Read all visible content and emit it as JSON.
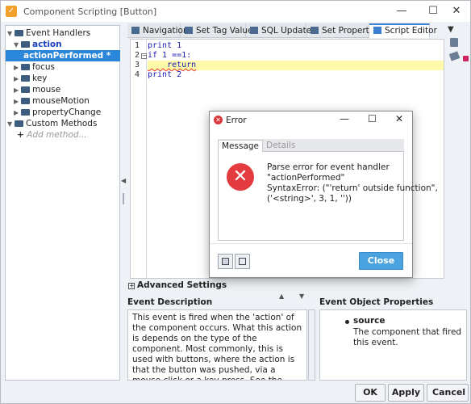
{
  "window": {
    "title": "Component Scripting [Button]",
    "controls": [
      "—",
      "☐",
      "✕"
    ]
  },
  "tree": {
    "items": [
      {
        "label": "Event Handlers"
      },
      {
        "label": "action"
      },
      {
        "label": "actionPerformed *"
      },
      {
        "label": "focus"
      },
      {
        "label": "key"
      },
      {
        "label": "mouse"
      },
      {
        "label": "mouseMotion"
      },
      {
        "label": "propertyChange"
      },
      {
        "label": "Custom Methods"
      },
      {
        "label": "Add method..."
      }
    ]
  },
  "tabs": [
    {
      "label": "Navigation"
    },
    {
      "label": "Set Tag Value"
    },
    {
      "label": "SQL Update"
    },
    {
      "label": "Set Property"
    },
    {
      "label": "Script Editor"
    }
  ],
  "editor": {
    "line_numbers": [
      "1",
      "2",
      "3",
      "4"
    ],
    "lines": [
      "print 1",
      "if 1 ==1:",
      "    return",
      "print 2"
    ]
  },
  "advanced_settings_label": "Advanced Settings",
  "event_description": {
    "heading": "Event Description",
    "text": "This event is fired when the 'action' of the component occurs. What this action is depends on the type of the component. Most commonly, this is used with buttons, where the action is that the button was pushed, via a mouse click or a key press. See the component reference for details on what the action means for other components."
  },
  "event_object_properties": {
    "heading": "Event Object Properties",
    "name": "source",
    "desc": "The component that fired this event."
  },
  "buttons": {
    "ok": "OK",
    "apply": "Apply",
    "cancel": "Cancel"
  },
  "dialog": {
    "title": "Error",
    "tabs": [
      "Message",
      "Details"
    ],
    "message_lines": [
      "Parse error for event handler",
      "\"actionPerformed\"",
      "SyntaxError: (\"'return' outside function\",",
      "('<string>', 3, 1, ''))"
    ],
    "close_label": "Close"
  },
  "colors": {
    "selection": "#2a86d9",
    "close_button": "#4aa3df",
    "error_icon": "#e33b3f",
    "keyword": "#1b1bb4",
    "highlight_line": "#fff9a8"
  }
}
